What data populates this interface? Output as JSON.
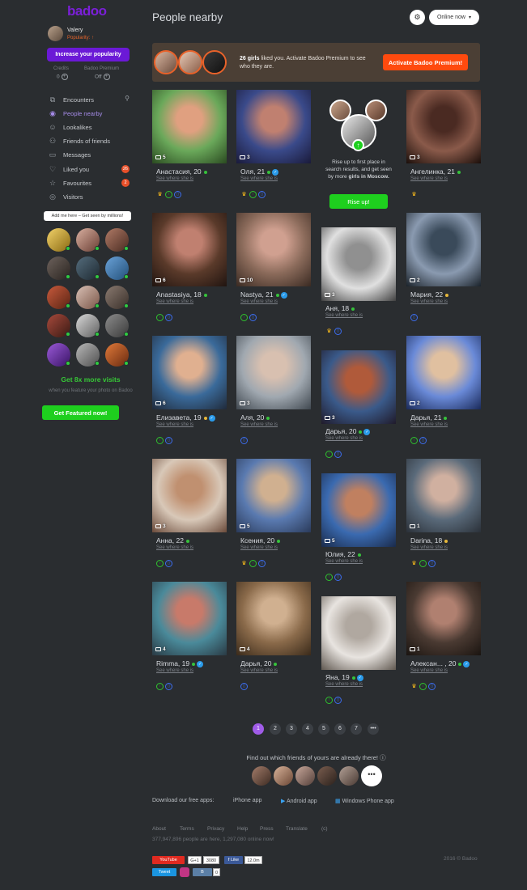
{
  "app": {
    "logo": "badoo"
  },
  "user": {
    "name": "Valery",
    "popularity": "Popularity: ↑"
  },
  "sidebar": {
    "popularity_button": "Increase your popularity",
    "credits_label": "Credits",
    "credits_value": "0",
    "premium_label": "Badoo Premium",
    "premium_value": "Off",
    "nav": [
      {
        "label": "Encounters",
        "icon": "encounters-icon",
        "extra": "⚲"
      },
      {
        "label": "People nearby",
        "icon": "location-icon",
        "active": true
      },
      {
        "label": "Lookalikes",
        "icon": "lookalikes-icon"
      },
      {
        "label": "Friends of friends",
        "icon": "friends-icon"
      },
      {
        "label": "Messages",
        "icon": "messages-icon"
      },
      {
        "label": "Liked you",
        "icon": "heart-icon",
        "badge": "26"
      },
      {
        "label": "Favourites",
        "icon": "star-icon",
        "badge": "2"
      },
      {
        "label": "Visitors",
        "icon": "eye-icon"
      }
    ],
    "tooltip": "Add me here – Get seen by millions!",
    "featured_title": "Get 8x more visits",
    "featured_sub": "when you feature your photo on Badoo",
    "featured_button": "Get Featured now!"
  },
  "header": {
    "title": "People nearby",
    "filter_icon": "filter-icon",
    "online_select": "Online now"
  },
  "banner": {
    "count": "26 girls",
    "text": "liked you. Activate Badoo Premium to see who they are.",
    "button": "Activate Badoo Premium!"
  },
  "rise": {
    "text_1": "Rise up to first place in search results, and get seen by more",
    "text_2": "girls in Moscow.",
    "button": "Rise up!"
  },
  "see_where": "See where she is",
  "people": [
    {
      "name": "Анастасия, 20",
      "photos": "5",
      "icons": [
        "y",
        "g",
        "b"
      ],
      "status": "on"
    },
    {
      "name": "Оля, 21",
      "photos": "3",
      "icons": [
        "y",
        "g",
        "b"
      ],
      "status": "on",
      "verified": true
    },
    {
      "name": "Ангелинка, 21",
      "photos": "3",
      "icons": [
        "y"
      ],
      "status": "on"
    },
    {
      "name": "Anastasiya, 18",
      "photos": "6",
      "icons": [
        "g",
        "b"
      ],
      "status": "on"
    },
    {
      "name": "Nastya, 21",
      "photos": "10",
      "icons": [
        "g",
        "b"
      ],
      "status": "on",
      "verified": true
    },
    {
      "name": "Аня, 18",
      "photos": "3",
      "icons": [
        "y",
        "b"
      ],
      "status": "on"
    },
    {
      "name": "Мария, 22",
      "photos": "2",
      "icons": [
        "b"
      ],
      "status": "y"
    },
    {
      "name": "Елизавета, 19",
      "photos": "6",
      "icons": [
        "g",
        "b"
      ],
      "status": "y",
      "verified": true
    },
    {
      "name": "Аля, 20",
      "photos": "3",
      "icons": [
        "b"
      ],
      "status": "on"
    },
    {
      "name": "Дарья, 20",
      "photos": "3",
      "icons": [
        "g",
        "b"
      ],
      "status": "on",
      "verified": true
    },
    {
      "name": "Дарья, 21",
      "photos": "2",
      "icons": [
        "g",
        "b"
      ],
      "status": "on"
    },
    {
      "name": "Анна, 22",
      "photos": "3",
      "icons": [
        "g",
        "b"
      ],
      "status": "on"
    },
    {
      "name": "Ксения, 20",
      "photos": "5",
      "icons": [
        "y",
        "g",
        "b"
      ],
      "status": "on"
    },
    {
      "name": "Юлия, 22",
      "photos": "5",
      "icons": [
        "g",
        "b"
      ],
      "status": "on"
    },
    {
      "name": "Darina, 18",
      "photos": "1",
      "icons": [
        "y",
        "g",
        "b"
      ],
      "status": "y"
    },
    {
      "name": "Rimma, 19",
      "photos": "4",
      "icons": [
        "g",
        "b"
      ],
      "status": "on",
      "verified": true
    },
    {
      "name": "Дарья, 20",
      "photos": "4",
      "icons": [
        "b"
      ],
      "status": "on"
    },
    {
      "name": "Яна, 19",
      "photos": "",
      "icons": [
        "g",
        "b"
      ],
      "status": "on",
      "verified": true
    },
    {
      "name": "Алексан... , 20",
      "photos": "1",
      "icons": [
        "y",
        "g",
        "b"
      ],
      "status": "on",
      "verified": true
    }
  ],
  "pagination": [
    "1",
    "2",
    "3",
    "4",
    "5",
    "6",
    "7",
    "•••"
  ],
  "friends_text": "Find out which friends of yours are already there!",
  "friends_more": "•••",
  "downloads": {
    "label": "Download our free apps:",
    "apps": [
      "iPhone app",
      "Android app",
      "Windows Phone app"
    ]
  },
  "footer": {
    "links": [
      "About",
      "Terms",
      "Privacy",
      "Help",
      "Press",
      "Translate",
      "(c)"
    ],
    "stats": "377,947,896 people are here, 1,297,080 online now!",
    "copyright": "2016 © Badoo",
    "social": {
      "youtube": "YouTube",
      "gplus": "G+1",
      "gplus_count": "3080",
      "fb": "Like",
      "fb_count": "12.0m",
      "tweet": "Tweet",
      "vk_count": "0"
    }
  },
  "colors": {
    "accent": "#6b19d6",
    "green": "#1ecf1e",
    "orange": "#ff4a0e",
    "bg": "#2a2d30"
  }
}
